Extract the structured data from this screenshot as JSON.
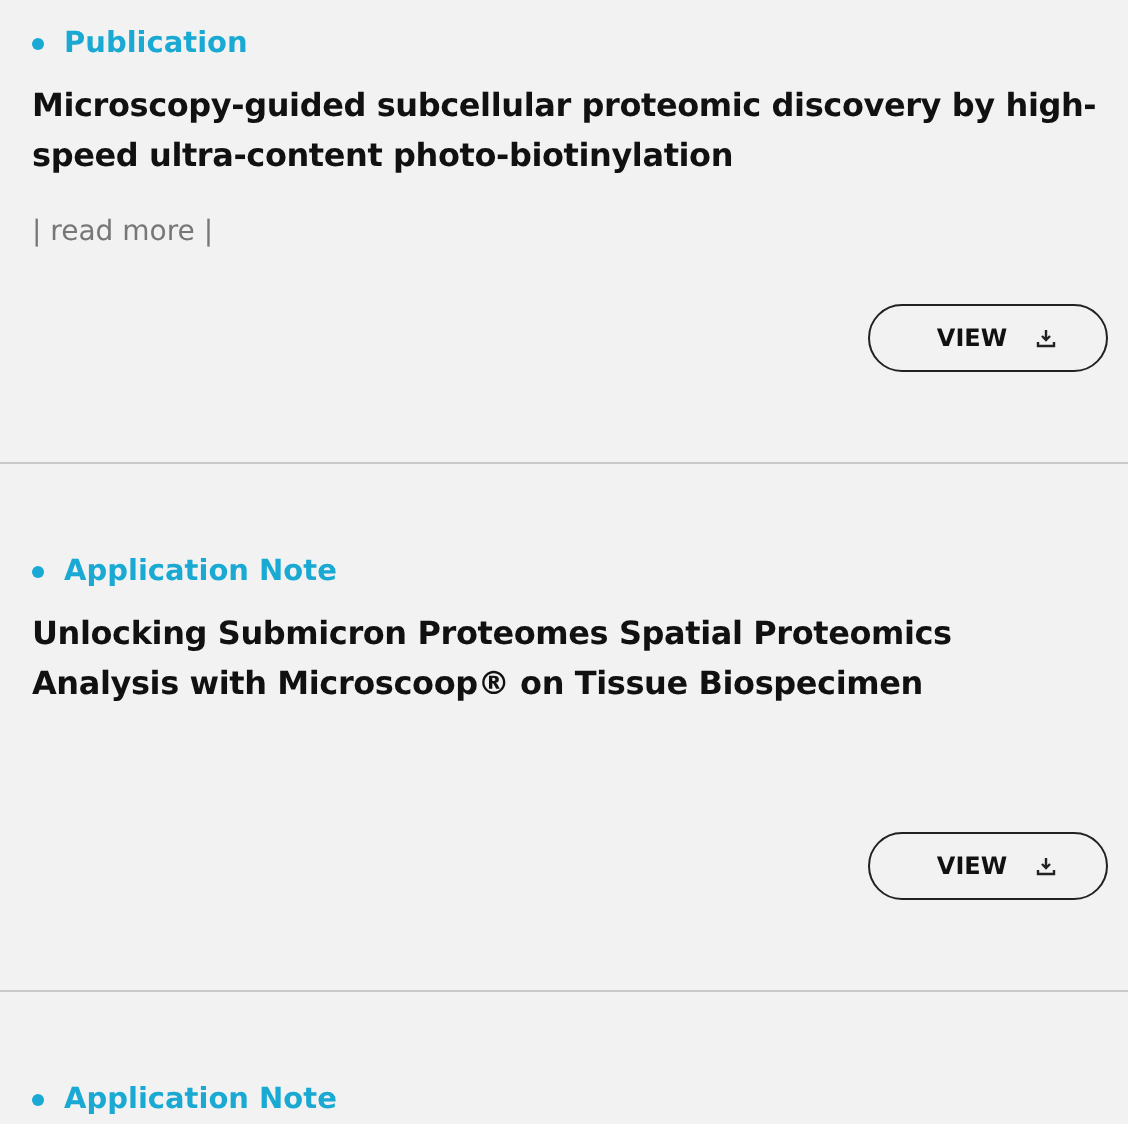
{
  "items": [
    {
      "category": "Publication",
      "title": "Microscopy-guided subcellular proteomic discovery by high-speed ultra-content photo-biotinylation",
      "read_more": "| read more |",
      "button": "VIEW"
    },
    {
      "category": "Application Note",
      "title": "Unlocking Submicron Proteomes Spatial Proteomics Analysis with Microscoop® on Tissue Biospecimen",
      "button": "VIEW"
    },
    {
      "category": "Application Note"
    }
  ]
}
